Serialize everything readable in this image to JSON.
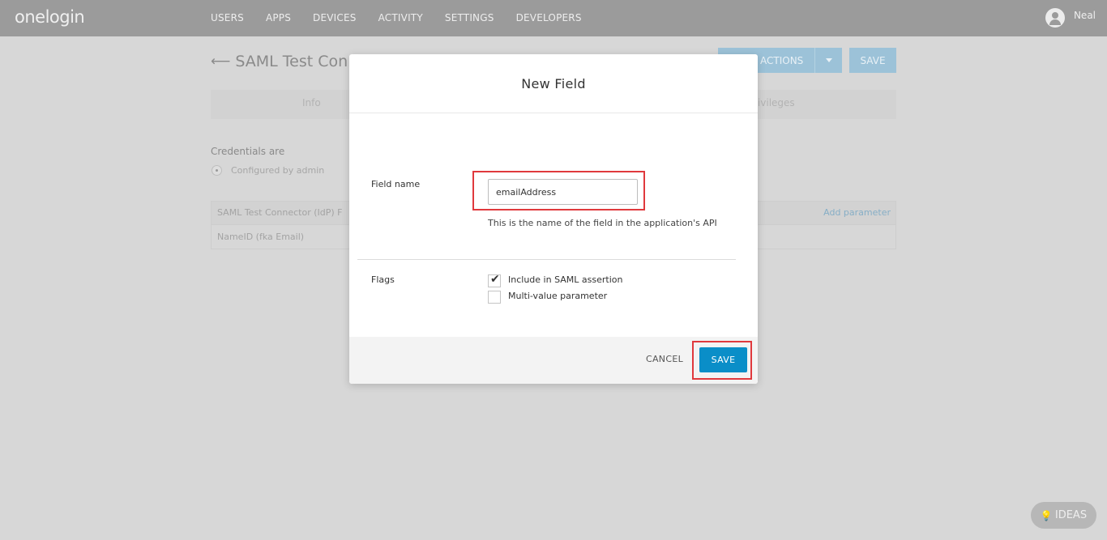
{
  "topbar": {
    "logo": "onelogin",
    "nav": [
      "USERS",
      "APPS",
      "DEVICES",
      "ACTIVITY",
      "SETTINGS",
      "DEVELOPERS"
    ],
    "user_name": "Neal"
  },
  "background": {
    "title": "SAML Test Conn",
    "more_actions": "ACTIONS",
    "save": "SAVE",
    "tab_info": "Info",
    "tab_privileges": "rivileges",
    "credentials_label": "Credentials are",
    "credentials_value": "Configured by admin",
    "params_header": "SAML Test Connector (IdP) F",
    "add_parameter": "Add parameter",
    "param_row": "NameID (fka Email)",
    "ideas": "IDEAS"
  },
  "modal": {
    "title": "New Field",
    "field_name_label": "Field name",
    "field_name_value": "emailAddress",
    "help_text": "This is the name of the field in the application's API",
    "flags_label": "Flags",
    "flags": [
      {
        "label": "Include in SAML assertion",
        "checked": true
      },
      {
        "label": "Multi-value parameter",
        "checked": false
      }
    ],
    "cancel": "CANCEL",
    "save": "SAVE"
  },
  "colors": {
    "accent": "#0a8ec8",
    "highlight": "#e0393d",
    "topbar": "#9b9b9b"
  }
}
